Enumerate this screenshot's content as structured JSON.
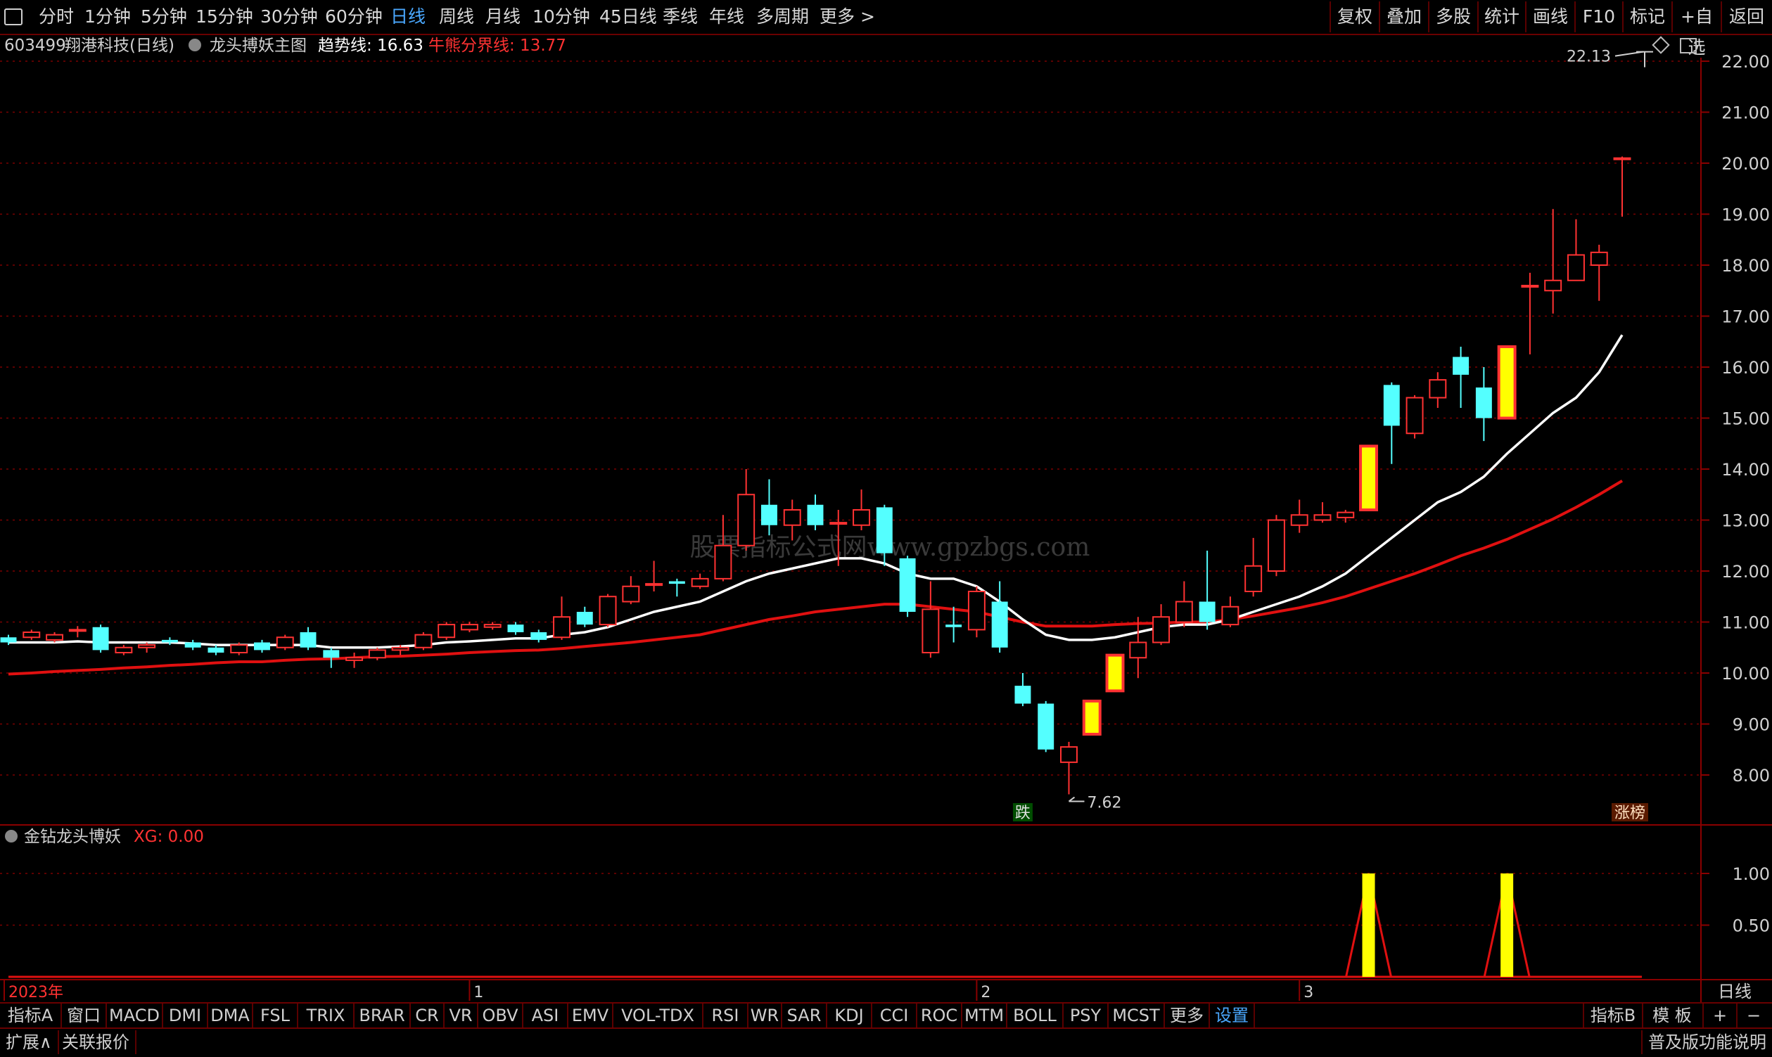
{
  "toolbar": {
    "periods": [
      "分时",
      "1分钟",
      "5分钟",
      "15分钟",
      "30分钟",
      "60分钟",
      "日线",
      "周线",
      "月线",
      "10分钟",
      "45日线",
      "季线",
      "年线",
      "多周期",
      "更多 >"
    ],
    "active_period": "日线",
    "right_buttons": [
      "复权",
      "叠加",
      "多股",
      "统计",
      "画线",
      "F10",
      "标记",
      "+自选",
      "返回"
    ]
  },
  "stock": {
    "code": "603499",
    "name": "翔港科技(日线)",
    "indicator_name": "龙头搏妖主图",
    "trend_label": "趋势线: 16.63",
    "bull_bear_label": "牛熊分界线: 13.77"
  },
  "chart_data": {
    "type": "candlestick",
    "price_axis": {
      "ticks": [
        "22.00",
        "21.00",
        "20.00",
        "19.00",
        "18.00",
        "17.00",
        "16.00",
        "15.00",
        "14.00",
        "13.00",
        "12.00",
        "11.00",
        "10.00",
        "9.00",
        "8.00"
      ]
    },
    "time_labels": [
      "2023年",
      "1",
      "2",
      "3"
    ],
    "annotations": {
      "high": "22.13",
      "low": "7.62",
      "down_tag": "跌",
      "limit_up_tag": "涨榜"
    },
    "watermark": "股票指标公式网www.gpzbgs.com",
    "candles": [
      {
        "o": 10.7,
        "c": 10.6,
        "h": 10.75,
        "l": 10.55
      },
      {
        "o": 10.7,
        "c": 10.8,
        "h": 10.85,
        "l": 10.65
      },
      {
        "o": 10.65,
        "c": 10.75,
        "h": 10.8,
        "l": 10.6
      },
      {
        "o": 10.85,
        "c": 10.85,
        "h": 10.92,
        "l": 10.7
      },
      {
        "o": 10.9,
        "c": 10.45,
        "h": 10.95,
        "l": 10.4
      },
      {
        "o": 10.4,
        "c": 10.5,
        "h": 10.55,
        "l": 10.35
      },
      {
        "o": 10.5,
        "c": 10.55,
        "h": 10.6,
        "l": 10.4
      },
      {
        "o": 10.65,
        "c": 10.6,
        "h": 10.7,
        "l": 10.55
      },
      {
        "o": 10.6,
        "c": 10.5,
        "h": 10.65,
        "l": 10.45
      },
      {
        "o": 10.5,
        "c": 10.4,
        "h": 10.55,
        "l": 10.35
      },
      {
        "o": 10.4,
        "c": 10.55,
        "h": 10.6,
        "l": 10.35
      },
      {
        "o": 10.6,
        "c": 10.45,
        "h": 10.65,
        "l": 10.4
      },
      {
        "o": 10.5,
        "c": 10.7,
        "h": 10.75,
        "l": 10.45
      },
      {
        "o": 10.8,
        "c": 10.5,
        "h": 10.9,
        "l": 10.45
      },
      {
        "o": 10.45,
        "c": 10.3,
        "h": 10.5,
        "l": 10.1
      },
      {
        "o": 10.25,
        "c": 10.3,
        "h": 10.4,
        "l": 10.1
      },
      {
        "o": 10.3,
        "c": 10.45,
        "h": 10.5,
        "l": 10.25
      },
      {
        "o": 10.45,
        "c": 10.5,
        "h": 10.55,
        "l": 10.35
      },
      {
        "o": 10.5,
        "c": 10.75,
        "h": 10.8,
        "l": 10.45
      },
      {
        "o": 10.7,
        "c": 10.95,
        "h": 11.0,
        "l": 10.65
      },
      {
        "o": 10.85,
        "c": 10.95,
        "h": 11.0,
        "l": 10.8
      },
      {
        "o": 10.9,
        "c": 10.95,
        "h": 11.0,
        "l": 10.85
      },
      {
        "o": 10.95,
        "c": 10.8,
        "h": 11.0,
        "l": 10.75
      },
      {
        "o": 10.8,
        "c": 10.65,
        "h": 10.85,
        "l": 10.6
      },
      {
        "o": 10.7,
        "c": 11.1,
        "h": 11.5,
        "l": 10.65
      },
      {
        "o": 11.2,
        "c": 10.95,
        "h": 11.3,
        "l": 10.9
      },
      {
        "o": 10.95,
        "c": 11.5,
        "h": 11.55,
        "l": 10.9
      },
      {
        "o": 11.4,
        "c": 11.7,
        "h": 11.9,
        "l": 11.35
      },
      {
        "o": 11.75,
        "c": 11.75,
        "h": 12.2,
        "l": 11.6
      },
      {
        "o": 11.8,
        "c": 11.75,
        "h": 11.85,
        "l": 11.5
      },
      {
        "o": 11.7,
        "c": 11.85,
        "h": 11.95,
        "l": 11.65
      },
      {
        "o": 11.85,
        "c": 12.5,
        "h": 13.1,
        "l": 11.8
      },
      {
        "o": 12.5,
        "c": 13.5,
        "h": 14.0,
        "l": 12.4
      },
      {
        "o": 13.3,
        "c": 12.9,
        "h": 13.8,
        "l": 12.7
      },
      {
        "o": 12.9,
        "c": 13.2,
        "h": 13.4,
        "l": 12.6
      },
      {
        "o": 13.3,
        "c": 12.9,
        "h": 13.5,
        "l": 12.8
      },
      {
        "o": 12.95,
        "c": 12.95,
        "h": 13.2,
        "l": 12.1
      },
      {
        "o": 12.9,
        "c": 13.2,
        "h": 13.6,
        "l": 12.8
      },
      {
        "o": 13.25,
        "c": 12.35,
        "h": 13.3,
        "l": 12.1
      },
      {
        "o": 12.25,
        "c": 11.2,
        "h": 12.3,
        "l": 11.1
      },
      {
        "o": 10.4,
        "c": 11.25,
        "h": 11.8,
        "l": 10.3
      },
      {
        "o": 10.95,
        "c": 10.9,
        "h": 11.3,
        "l": 10.6
      },
      {
        "o": 10.85,
        "c": 11.6,
        "h": 11.7,
        "l": 10.7
      },
      {
        "o": 11.4,
        "c": 10.5,
        "h": 11.8,
        "l": 10.4
      },
      {
        "o": 9.75,
        "c": 9.4,
        "h": 10.0,
        "l": 9.35
      },
      {
        "o": 9.4,
        "c": 8.5,
        "h": 9.45,
        "l": 8.45
      },
      {
        "o": 8.25,
        "c": 8.55,
        "h": 8.65,
        "l": 7.62
      },
      {
        "o": 8.8,
        "c": 9.45,
        "h": 9.45,
        "l": 8.8,
        "lim": 1
      },
      {
        "o": 9.65,
        "c": 10.35,
        "h": 10.35,
        "l": 9.65,
        "lim": 1
      },
      {
        "o": 10.3,
        "c": 10.6,
        "h": 11.1,
        "l": 9.9
      },
      {
        "o": 10.6,
        "c": 11.1,
        "h": 11.35,
        "l": 10.55
      },
      {
        "o": 11.0,
        "c": 11.4,
        "h": 11.8,
        "l": 10.9
      },
      {
        "o": 11.4,
        "c": 11.0,
        "h": 12.4,
        "l": 10.85
      },
      {
        "o": 10.95,
        "c": 11.3,
        "h": 11.5,
        "l": 10.9
      },
      {
        "o": 11.6,
        "c": 12.1,
        "h": 12.65,
        "l": 11.5
      },
      {
        "o": 12.0,
        "c": 13.0,
        "h": 13.1,
        "l": 11.9
      },
      {
        "o": 12.9,
        "c": 13.1,
        "h": 13.4,
        "l": 12.75
      },
      {
        "o": 13.0,
        "c": 13.1,
        "h": 13.35,
        "l": 12.95
      },
      {
        "o": 13.05,
        "c": 13.15,
        "h": 13.2,
        "l": 12.95
      },
      {
        "o": 13.2,
        "c": 14.45,
        "h": 14.45,
        "l": 13.2,
        "lim": 1
      },
      {
        "o": 15.65,
        "c": 14.85,
        "h": 15.7,
        "l": 14.1
      },
      {
        "o": 14.7,
        "c": 15.4,
        "h": 15.45,
        "l": 14.6
      },
      {
        "o": 15.4,
        "c": 15.75,
        "h": 15.9,
        "l": 15.2
      },
      {
        "o": 16.2,
        "c": 15.85,
        "h": 16.4,
        "l": 15.2
      },
      {
        "o": 15.6,
        "c": 15.0,
        "h": 16.0,
        "l": 14.55
      },
      {
        "o": 15.0,
        "c": 16.4,
        "h": 16.4,
        "l": 15.0,
        "lim": 1
      },
      {
        "o": 17.6,
        "c": 17.6,
        "h": 17.85,
        "l": 16.25
      },
      {
        "o": 17.5,
        "c": 17.7,
        "h": 19.1,
        "l": 17.05
      },
      {
        "o": 17.7,
        "c": 18.2,
        "h": 18.9,
        "l": 17.7
      },
      {
        "o": 18.0,
        "c": 18.25,
        "h": 18.4,
        "l": 17.3
      },
      {
        "o": 20.1,
        "c": 20.1,
        "h": 20.13,
        "l": 18.95
      }
    ],
    "trend_line": [
      10.6,
      10.6,
      10.6,
      10.62,
      10.6,
      10.6,
      10.6,
      10.6,
      10.58,
      10.55,
      10.55,
      10.55,
      10.55,
      10.55,
      10.5,
      10.5,
      10.5,
      10.52,
      10.55,
      10.6,
      10.62,
      10.65,
      10.68,
      10.68,
      10.75,
      10.8,
      10.9,
      11.05,
      11.2,
      11.3,
      11.4,
      11.6,
      11.8,
      11.95,
      12.05,
      12.15,
      12.25,
      12.25,
      12.15,
      11.95,
      11.85,
      11.85,
      11.7,
      11.4,
      11.05,
      10.75,
      10.65,
      10.65,
      10.7,
      10.8,
      10.9,
      10.95,
      10.95,
      11.05,
      11.2,
      11.35,
      11.5,
      11.7,
      11.95,
      12.3,
      12.65,
      13.0,
      13.35,
      13.55,
      13.85,
      14.3,
      14.7,
      15.1,
      15.4,
      15.9,
      16.63
    ],
    "bull_bear_line": [
      9.98,
      10.0,
      10.03,
      10.05,
      10.07,
      10.1,
      10.12,
      10.15,
      10.17,
      10.2,
      10.22,
      10.22,
      10.25,
      10.27,
      10.28,
      10.3,
      10.32,
      10.33,
      10.35,
      10.37,
      10.4,
      10.42,
      10.44,
      10.45,
      10.48,
      10.52,
      10.56,
      10.6,
      10.65,
      10.7,
      10.75,
      10.85,
      10.95,
      11.05,
      11.12,
      11.2,
      11.25,
      11.3,
      11.35,
      11.35,
      11.3,
      11.25,
      11.2,
      11.1,
      11.0,
      10.92,
      10.92,
      10.92,
      10.95,
      10.97,
      10.98,
      11.0,
      11.0,
      11.05,
      11.12,
      11.2,
      11.28,
      11.38,
      11.5,
      11.65,
      11.8,
      11.95,
      12.12,
      12.3,
      12.45,
      12.62,
      12.82,
      13.02,
      13.25,
      13.5,
      13.77
    ]
  },
  "sub_chart": {
    "name": "金钻龙头博妖",
    "xg_label": "XG: 0.00",
    "ticks": [
      "1.00",
      "0.50"
    ],
    "signals": [
      59,
      65
    ]
  },
  "bottom_tabs": [
    "指标A",
    "窗口",
    "MACD",
    "DMI",
    "DMA",
    "FSL",
    "TRIX",
    "BRAR",
    "CR",
    "VR",
    "OBV",
    "ASI",
    "EMV",
    "VOL-TDX",
    "RSI",
    "WR",
    "SAR",
    "KDJ",
    "CCI",
    "ROC",
    "MTM",
    "BOLL",
    "PSY",
    "MCST",
    "更多",
    "设置"
  ],
  "bottom_right": {
    "indicator_b": "指标B",
    "template": "模 板",
    "plus": "+",
    "minus": "−"
  },
  "period_tag": "日线",
  "status": {
    "expand": "扩展∧",
    "linked_quotes": "关联报价",
    "version_note": "普及版功能说明"
  },
  "colors": {
    "up": "#ff3232",
    "down": "#54ffff",
    "limit": "#ffff00",
    "trend": "#ffffff",
    "bull_bear": "#e01010",
    "grid": "#7a0000"
  }
}
